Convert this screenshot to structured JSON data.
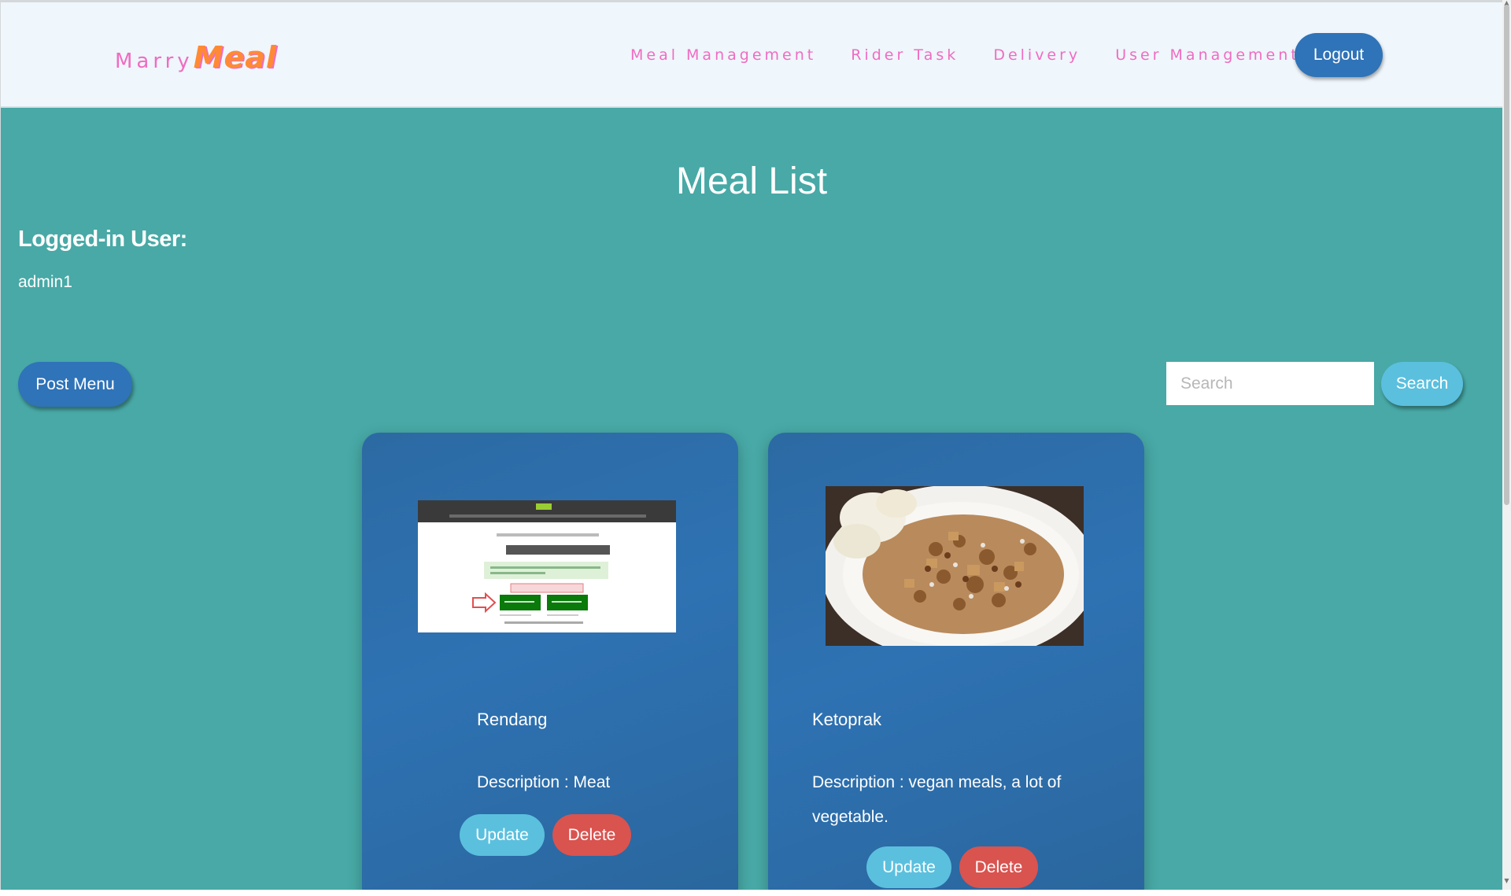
{
  "navbar": {
    "brand_marry": "Marry",
    "brand_meal": "Meal",
    "links": [
      "Meal Management",
      "Rider Task",
      "Delivery",
      "User Management"
    ],
    "logout_label": "Logout"
  },
  "main": {
    "title": "Meal List",
    "logged_in_label": "Logged-in User:",
    "username": "admin1",
    "post_menu_label": "Post Menu",
    "search": {
      "placeholder": "Search",
      "button_label": "Search"
    }
  },
  "meals": [
    {
      "name": "Rendang",
      "description": "Description : Meat",
      "update_label": "Update",
      "delete_label": "Delete",
      "image": "webpage-screenshot"
    },
    {
      "name": "Ketoprak",
      "description": "Description : vegan meals, a lot of vegetable.",
      "update_label": "Update",
      "delete_label": "Delete",
      "image": "ketoprak-food-photo"
    }
  ],
  "colors": {
    "background": "#48a9a6",
    "navbar": "#eff6fc",
    "nav_link": "#f06cc1",
    "brand_meal": "#ff8a35",
    "primary_button": "#2f73b8",
    "info_button": "#5bc0de",
    "danger_button": "#d9534f",
    "card": "#2e72b3"
  }
}
